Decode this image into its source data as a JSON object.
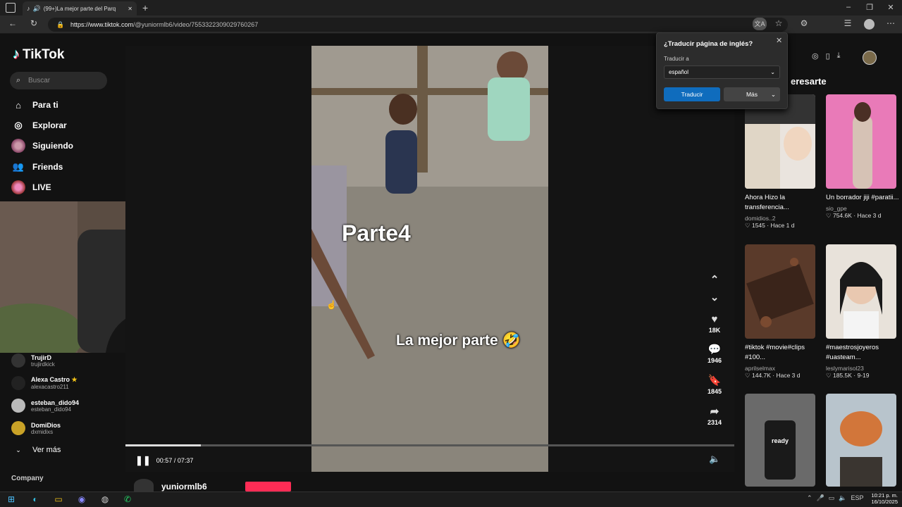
{
  "browser": {
    "tab_title": "(99+)La mejor parte del Parq",
    "url_prefix": "https://www.tiktok.com",
    "url_path": "/@yuniormlb6/video/7553322309029760267"
  },
  "translate_popup": {
    "title": "¿Traducir página de inglés?",
    "translate_to_label": "Traducir a",
    "language": "español",
    "translate_button": "Traducir",
    "more_button": "Más"
  },
  "sidebar": {
    "logo": "TikTok",
    "search_placeholder": "Buscar",
    "nav": [
      {
        "label": "Para ti",
        "icon": "home-icon"
      },
      {
        "label": "Explorar",
        "icon": "compass-icon"
      },
      {
        "label": "Siguiendo",
        "icon": "avatar-icon"
      },
      {
        "label": "Friends",
        "icon": "friends-icon"
      },
      {
        "label": "LIVE",
        "icon": "live-avatar-icon"
      }
    ],
    "following": [
      {
        "name": "TrujirD",
        "handle": "trujirdkick"
      },
      {
        "name": "Alexa Castro",
        "handle": "alexacastro211",
        "star": "★"
      },
      {
        "name": "esteban_dido94",
        "handle": "esteban_dido94"
      },
      {
        "name": "DomiDios",
        "handle": "dxmidixs"
      }
    ],
    "see_more": "Ver más",
    "company": "Company"
  },
  "video": {
    "caption_part": "Parte4",
    "caption_main": "La mejor parte 🤣",
    "likes": "18K",
    "comments": "1946",
    "saves": "1845",
    "shares": "2314",
    "time": "00:57 / 07:37",
    "progress": 0.124,
    "author": "yuniormlb6"
  },
  "right_panel": {
    "heading": "eresarte",
    "cards": [
      {
        "title": "Ahora Hizo la transferencia...",
        "user": "domidios..2",
        "stats": "♡ 1545 · Hace 1 d"
      },
      {
        "title": "Un borrador jiji #paratii...",
        "user": "sio_gpe",
        "stats": "♡ 754.6K · Hace 3 d"
      },
      {
        "title": "#tiktok #movie#clips #100...",
        "user": "aprilselmax",
        "stats": "♡ 144.7K · Hace 3 d"
      },
      {
        "title": "#maestrosjoyeros #uasteam...",
        "user": "leslymarisol23",
        "stats": "♡ 185.5K · 9-19"
      },
      {
        "title": "ready",
        "user": "",
        "stats": ""
      }
    ]
  },
  "taskbar": {
    "language": "ESP",
    "time": "10:21 p. m.",
    "date": "16/10/2025"
  }
}
